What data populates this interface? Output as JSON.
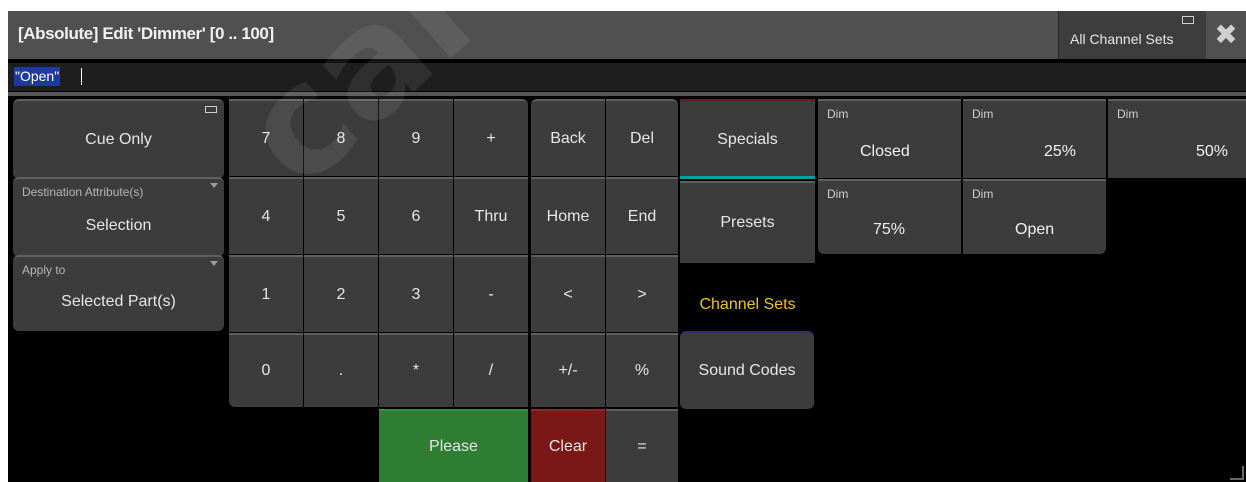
{
  "window": {
    "title": "[Absolute] Edit 'Dimmer' [0 .. 100]",
    "channel_sets_button": "All Channel Sets",
    "close_icon": "close-icon"
  },
  "command_line": {
    "value": "\"Open\""
  },
  "left_panel": {
    "cue_only": "Cue Only",
    "destination_label": "Destination Attribute(s)",
    "destination_value": "Selection",
    "apply_to_label": "Apply to",
    "apply_to_value": "Selected Part(s)"
  },
  "keypad": {
    "k7": "7",
    "k8": "8",
    "k9": "9",
    "plus": "+",
    "k4": "4",
    "k5": "5",
    "k6": "6",
    "thru": "Thru",
    "k1": "1",
    "k2": "2",
    "k3": "3",
    "minus": "-",
    "k0": "0",
    "dot": ".",
    "star": "*",
    "slash": "/",
    "please": "Please"
  },
  "edit_keys": {
    "back": "Back",
    "del": "Del",
    "home": "Home",
    "end": "End",
    "left": "<",
    "right": ">",
    "plusminus": "+/-",
    "percent": "%",
    "clear": "Clear",
    "equals": "="
  },
  "categories": {
    "specials": "Specials",
    "presets": "Presets",
    "channel_sets": "Channel Sets",
    "sound_codes": "Sound Codes"
  },
  "presets": [
    {
      "attr": "Dim",
      "value": "Closed"
    },
    {
      "attr": "Dim",
      "value": "25%"
    },
    {
      "attr": "Dim",
      "value": "50%"
    },
    {
      "attr": "Dim",
      "value": "75%"
    },
    {
      "attr": "Dim",
      "value": "Open"
    }
  ],
  "watermark": "carlosmen"
}
